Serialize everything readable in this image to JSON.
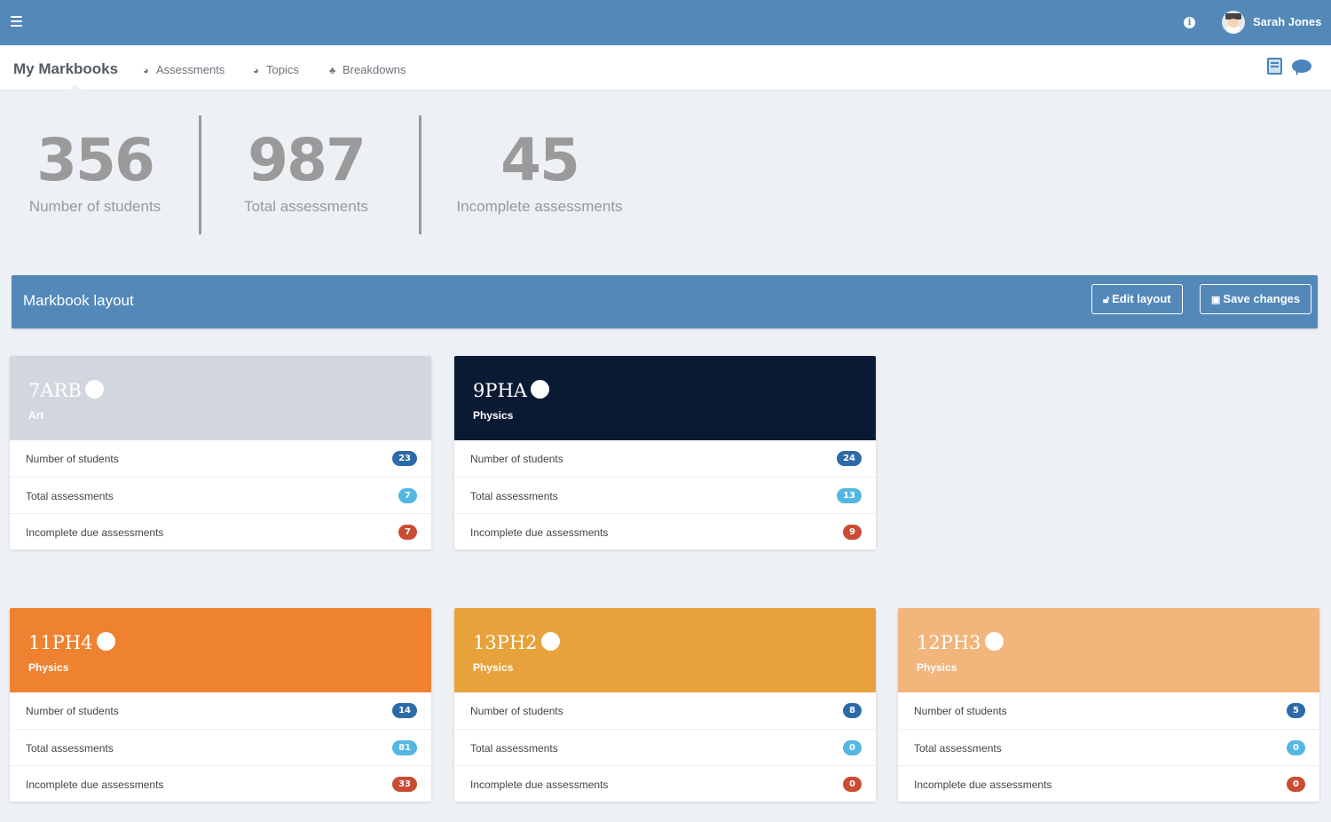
{
  "topbar": {
    "menu_icon": "hamburger-icon",
    "info_icon": "info-icon",
    "user_name": "Sarah Jones",
    "colors": {
      "bar": "#5388b9"
    }
  },
  "subnav": {
    "brand": "My Markbooks",
    "links": [
      {
        "label": "Assessments",
        "icon": "dashboard-icon"
      },
      {
        "label": "Topics",
        "icon": "dashboard-icon"
      },
      {
        "label": "Breakdowns",
        "icon": "sitemap-icon"
      }
    ],
    "right_icons": [
      "book-icon",
      "chat-icon"
    ]
  },
  "stats": [
    {
      "value": "356",
      "label": "Number of students"
    },
    {
      "value": "987",
      "label": "Total assessments"
    },
    {
      "value": "45",
      "label": "Incomplete assessments"
    }
  ],
  "layout_bar": {
    "title": "Markbook layout",
    "edit_label": "Edit layout",
    "save_label": "Save changes"
  },
  "row_labels": {
    "students": "Number of students",
    "total": "Total assessments",
    "incomplete": "Incomplete due assessments"
  },
  "badge_colors": {
    "students": "#2c6aa8",
    "total": "#53b7e1",
    "incomplete": "#c94c33"
  },
  "cards": [
    {
      "code": "7ARB",
      "subject": "Art",
      "color": "#d2d6de",
      "students": "23",
      "total": "7",
      "incomplete": "7"
    },
    {
      "code": "9PHA",
      "subject": "Physics",
      "color": "#0b1a33",
      "students": "24",
      "total": "13",
      "incomplete": "9"
    },
    {
      "code": "11PH4",
      "subject": "Physics",
      "color": "#ee8230",
      "students": "14",
      "total": "81",
      "incomplete": "33"
    },
    {
      "code": "13PH2",
      "subject": "Physics",
      "color": "#e8a23b",
      "students": "8",
      "total": "0",
      "incomplete": "0"
    },
    {
      "code": "12PH3",
      "subject": "Physics",
      "color": "#f2b57c",
      "students": "5",
      "total": "0",
      "incomplete": "0"
    }
  ]
}
